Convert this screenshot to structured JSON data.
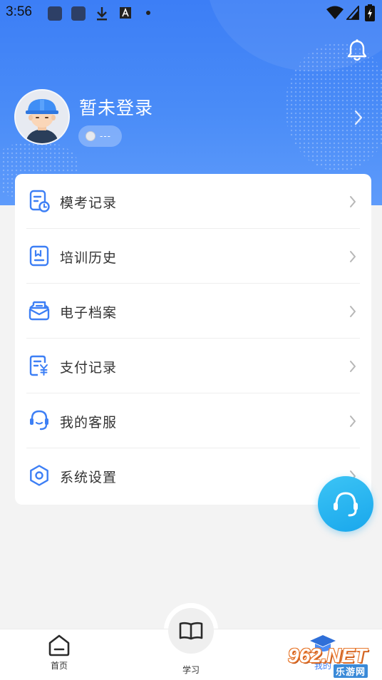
{
  "status_bar": {
    "time": "3:56"
  },
  "profile": {
    "username": "暂未登录",
    "badge_text": "---"
  },
  "menu": {
    "items": [
      {
        "label": "模考记录",
        "icon": "exam-record-icon"
      },
      {
        "label": "培训历史",
        "icon": "training-history-icon"
      },
      {
        "label": "电子档案",
        "icon": "e-archive-icon"
      },
      {
        "label": "支付记录",
        "icon": "payment-record-icon"
      },
      {
        "label": "我的客服",
        "icon": "customer-service-icon"
      },
      {
        "label": "系统设置",
        "icon": "settings-icon"
      }
    ]
  },
  "bottom_nav": {
    "home_label": "首页",
    "study_label": "学习",
    "mine_label": "我的"
  },
  "watermark": {
    "brand": "962.NET",
    "sub": "乐游网"
  },
  "colors": {
    "header_blue": "#3c7ef6",
    "icon_blue": "#3d7ff5",
    "fab_blue": "#19a7ec"
  }
}
